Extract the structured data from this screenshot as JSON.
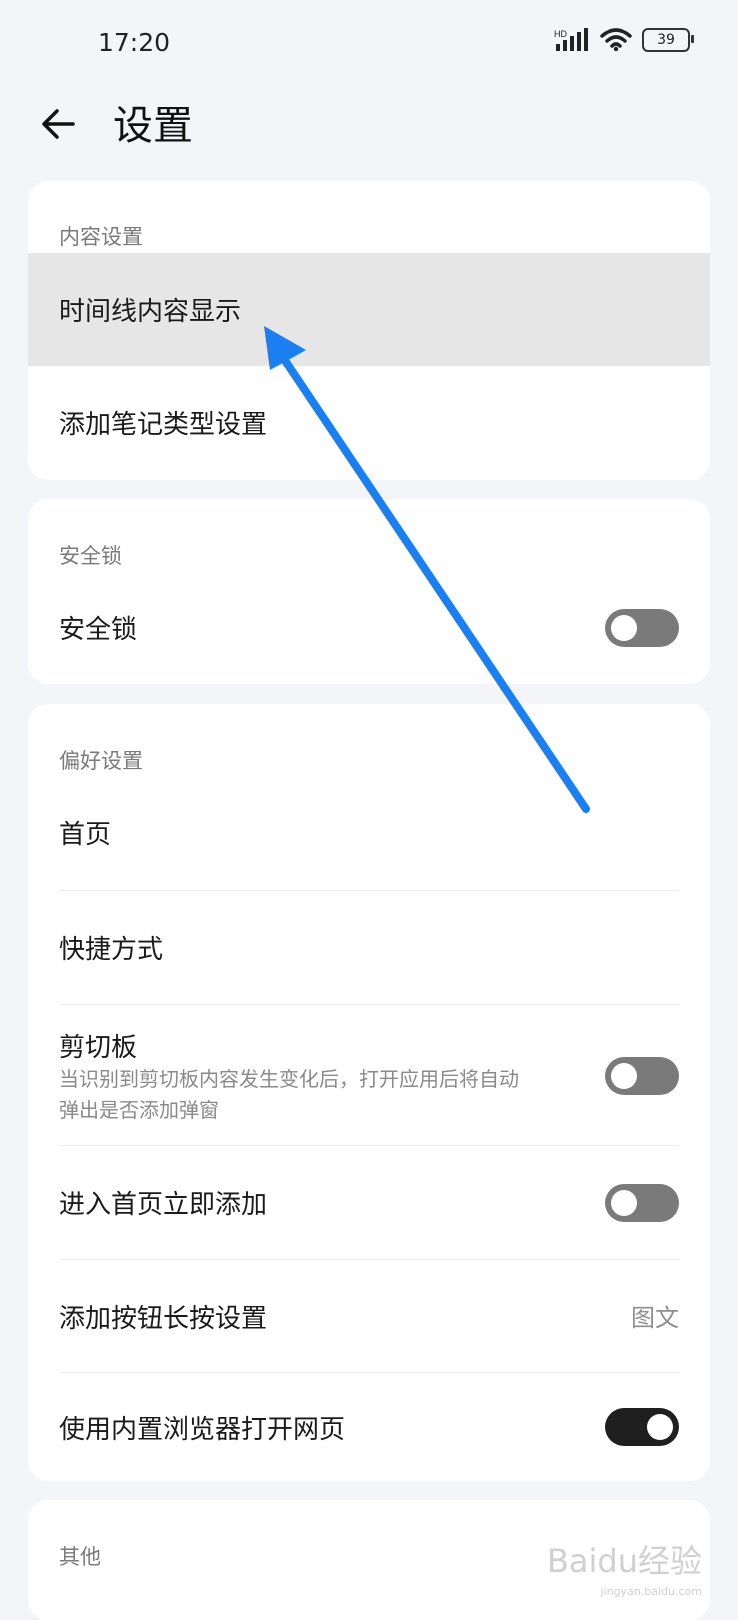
{
  "status_bar": {
    "time": "17:20",
    "network_label": "HD",
    "battery": "39"
  },
  "header": {
    "title": "设置"
  },
  "sections": {
    "content": {
      "title": "内容设置",
      "items": [
        {
          "label": "时间线内容显示"
        },
        {
          "label": "添加笔记类型设置"
        }
      ]
    },
    "security": {
      "title": "安全锁",
      "items": [
        {
          "label": "安全锁",
          "toggle": false
        }
      ]
    },
    "preferences": {
      "title": "偏好设置",
      "items": [
        {
          "label": "首页"
        },
        {
          "label": "快捷方式"
        },
        {
          "label": "剪切板",
          "description": "当识别到剪切板内容发生变化后，打开应用后将自动弹出是否添加弹窗",
          "toggle": false
        },
        {
          "label": "进入首页立即添加",
          "toggle": false
        },
        {
          "label": "添加按钮长按设置",
          "value": "图文"
        },
        {
          "label": "使用内置浏览器打开网页",
          "toggle": true
        }
      ]
    },
    "other": {
      "title": "其他"
    }
  },
  "watermark": {
    "brand": "Baidu经验",
    "url": "jingyan.baidu.com"
  },
  "colors": {
    "annotation_arrow": "#1a7ff0",
    "highlight": "#e6e6e6",
    "toggle_off": "#7a7a7a",
    "toggle_on": "#1f1f1f"
  }
}
